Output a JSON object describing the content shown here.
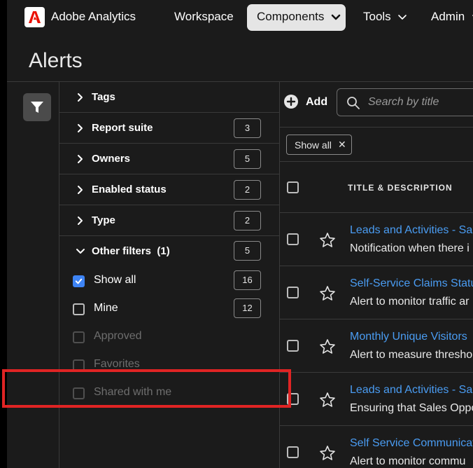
{
  "nav": {
    "app_title": "Adobe Analytics",
    "items": [
      {
        "label": "Workspace"
      },
      {
        "label": "Components"
      },
      {
        "label": "Tools"
      },
      {
        "label": "Admin"
      }
    ]
  },
  "page": {
    "title": "Alerts"
  },
  "filters": {
    "groups": [
      {
        "label": "Tags",
        "count": ""
      },
      {
        "label": "Report suite",
        "count": "3"
      },
      {
        "label": "Owners",
        "count": "5"
      },
      {
        "label": "Enabled status",
        "count": "2"
      },
      {
        "label": "Type",
        "count": "2"
      },
      {
        "label": "Other filters  (1)",
        "count": "5"
      }
    ],
    "options": [
      {
        "label": "Show all",
        "count": "16",
        "checked": true
      },
      {
        "label": "Mine",
        "count": "12",
        "checked": false
      },
      {
        "label": "Approved",
        "disabled": true
      },
      {
        "label": "Favorites",
        "disabled": true
      },
      {
        "label": "Shared with me",
        "disabled": true
      }
    ]
  },
  "toolbar": {
    "add_label": "Add",
    "search_placeholder": "Search by title"
  },
  "chips": [
    {
      "label": "Show all",
      "close": "✕"
    }
  ],
  "table": {
    "header": "TITLE & DESCRIPTION",
    "rows": [
      {
        "title": "Leads and Activities - Sal",
        "desc": "Notification when there i"
      },
      {
        "title": "Self-Service Claims Status",
        "desc": "Alert to monitor traffic ar"
      },
      {
        "title": "Monthly Unique Visitors",
        "desc": "Alert to measure thresho"
      },
      {
        "title": "Leads and Activities - Sal",
        "desc": "Ensuring that Sales Oppo"
      },
      {
        "title": "Self Service Communicat",
        "desc": "Alert to monitor commu"
      }
    ]
  },
  "colors": {
    "accent_blue": "#3e84f5",
    "link_blue": "#4a9cf2",
    "highlight_red": "#e02424",
    "adobe_red": "#eb1000"
  }
}
